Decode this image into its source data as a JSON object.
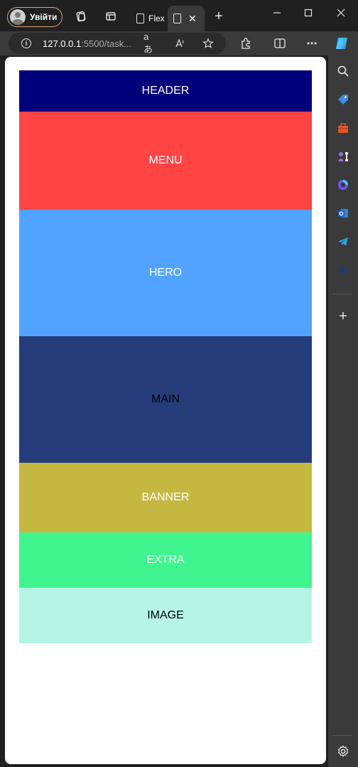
{
  "browser": {
    "profile_label": "Увійти",
    "tabs": [
      {
        "label": "Flex",
        "active": false
      },
      {
        "label": "",
        "active": true
      }
    ],
    "new_tab_symbol": "+",
    "address": {
      "host": "127.0.0.1",
      "rest": ":5500/task..."
    },
    "read_aloud_text": "aあ",
    "sidebar_icons": [
      "search-icon",
      "tag-icon",
      "toolbox-icon",
      "chess-icon",
      "copilot-icon",
      "outlook-icon",
      "telegram-icon",
      "hat-icon",
      "add-icon",
      "settings-icon"
    ]
  },
  "page": {
    "blocks": [
      {
        "label": "HEADER",
        "bg": "#00007a",
        "color": "#ffffff"
      },
      {
        "label": "MENU",
        "bg": "#ff4444",
        "color": "#ffffff"
      },
      {
        "label": "HERO",
        "bg": "#52a2ff",
        "color": "#ffffff"
      },
      {
        "label": "MAIN",
        "bg": "#253c7b",
        "color": "#000000"
      },
      {
        "label": "BANNER",
        "bg": "#c4b840",
        "color": "#ffffff"
      },
      {
        "label": "EXTRA",
        "bg": "#40f58f",
        "color": "#ffffff"
      },
      {
        "label": "IMAGE",
        "bg": "#b6f5e6",
        "color": "#000000"
      }
    ]
  }
}
